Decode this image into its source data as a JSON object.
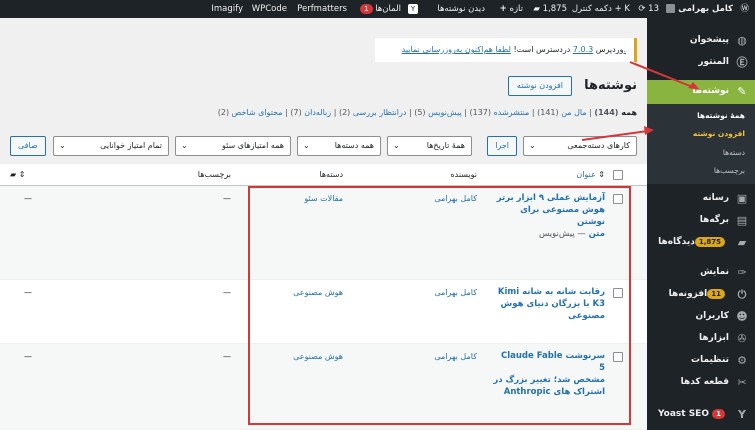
{
  "adminbar": {
    "site_name": "کامل بهرامی",
    "updates_count": "13",
    "control_menu": "دکمه کنترل + K",
    "comments_count": "1,875",
    "new_label": "تازه",
    "view_posts": "دیدن نوشته‌ها",
    "yoast_count": "1",
    "elementor_label": "المان‌ها",
    "perfmatters": "Perfmatters",
    "wpcode": "WPCode",
    "imagify": "Imagify"
  },
  "sidebar": {
    "items": [
      {
        "label": "پیشخوان",
        "icon": "dashboard-icon"
      },
      {
        "label": "المنتور",
        "icon": "elementor-icon"
      },
      {
        "label": "نوشته‌ها",
        "icon": "pin-icon"
      },
      {
        "label": "رسانه",
        "icon": "media-icon"
      },
      {
        "label": "برگه‌ها",
        "icon": "pages-icon"
      },
      {
        "label": "دیدگاه‌ها",
        "icon": "comments-icon",
        "count": "1,875"
      },
      {
        "label": "نمایش",
        "icon": "appearance-icon"
      },
      {
        "label": "افزونه‌ها",
        "icon": "plugins-icon",
        "count": "11"
      },
      {
        "label": "کاربران",
        "icon": "users-icon"
      },
      {
        "label": "ابزارها",
        "icon": "tools-icon"
      },
      {
        "label": "تنظیمات",
        "icon": "settings-icon"
      },
      {
        "label": "قطعه کدها",
        "icon": "code-icon"
      },
      {
        "label": "Yoast SEO",
        "icon": "yoast-icon",
        "count": "1"
      }
    ],
    "submenu": [
      "همهٔ نوشته‌ها",
      "افزودن نوشته",
      "دسته‌ها",
      "برچسب‌ها"
    ]
  },
  "notice": {
    "prefix": "وردپرس",
    "version": "7.0.3",
    "middle": "دردسترس است!",
    "link": "لطفا هم‌اکنون به‌روزرسانی نمایید."
  },
  "page": {
    "title": "نوشته‌ها",
    "add_button": "افزودن نوشته"
  },
  "filters": {
    "views": [
      {
        "label": "همه",
        "count": "(144)"
      },
      {
        "label": "مال من",
        "count": "(141)"
      },
      {
        "label": "منتشرشده",
        "count": "(137)"
      },
      {
        "label": "پیش‌نویس",
        "count": "(5)"
      },
      {
        "label": "درانتظار بررسی",
        "count": "(2)"
      },
      {
        "label": "زباله‌دان",
        "count": "(7)"
      },
      {
        "label": "محتوای شاخص",
        "count": "(2)"
      }
    ],
    "bulk_actions": "کارهای دسته‌جمعی",
    "apply": "اجرا",
    "all_dates": "همهٔ تاریخ‌ها",
    "all_categories": "همه دسته‌ها",
    "seo_scores": "همه امتیازهای سئو",
    "readability": "تمام امتیاز خوانایی",
    "filter_button": "صافی"
  },
  "table": {
    "headers": {
      "title": "عنوان",
      "author": "نویسنده",
      "categories": "دسته‌ها",
      "tags": "برچسب‌ها"
    },
    "rows": [
      {
        "title_lines": [
          "آزمایش عملی ۹ ابزار برتر",
          "هوش مصنوعی برای نوشتن"
        ],
        "title_last": "متن",
        "state": " — پیش‌نویس",
        "author": "کامل بهرامی",
        "category": "مقالات سئو",
        "tags": "—",
        "comments": "—"
      },
      {
        "title_lines": [
          "رقابت شانه به شانه Kimi",
          "K3 با بزرگان دنیای هوش",
          "مصنوعی"
        ],
        "title_last": "",
        "state": "",
        "author": "کامل بهرامی",
        "category": "هوش مصنوعی",
        "tags": "—",
        "comments": "—"
      },
      {
        "title_lines": [
          "سرنوشت Claude Fable 5",
          "مشخص شد؛ تغییر بزرگ در",
          "اشتراک های Anthropic"
        ],
        "title_last": "",
        "state": "",
        "author": "کامل بهرامی",
        "category": "هوش مصنوعی",
        "tags": "—",
        "comments": "—"
      }
    ]
  }
}
